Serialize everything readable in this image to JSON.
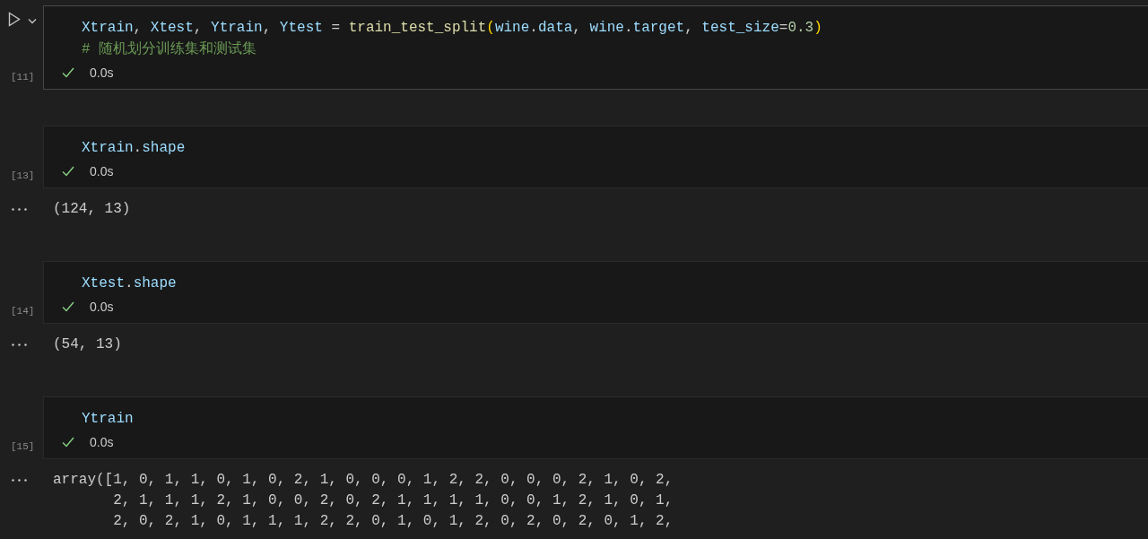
{
  "cells": [
    {
      "focused": true,
      "execution_count": "[11]",
      "succeeded": true,
      "duration": "0.0s",
      "code": [
        [
          {
            "t": "Xtrain",
            "kind": "var"
          },
          {
            "t": ", ",
            "kind": "plain"
          },
          {
            "t": "Xtest",
            "kind": "var"
          },
          {
            "t": ", ",
            "kind": "plain"
          },
          {
            "t": "Ytrain",
            "kind": "var"
          },
          {
            "t": ", ",
            "kind": "plain"
          },
          {
            "t": "Ytest",
            "kind": "var"
          },
          {
            "t": " = ",
            "kind": "plain"
          },
          {
            "t": "train_test_split",
            "kind": "func"
          },
          {
            "t": "(",
            "kind": "bracket"
          },
          {
            "t": "wine",
            "kind": "var"
          },
          {
            "t": ".",
            "kind": "plain"
          },
          {
            "t": "data",
            "kind": "var"
          },
          {
            "t": ", ",
            "kind": "plain"
          },
          {
            "t": "wine",
            "kind": "var"
          },
          {
            "t": ".",
            "kind": "plain"
          },
          {
            "t": "target",
            "kind": "var"
          },
          {
            "t": ", ",
            "kind": "plain"
          },
          {
            "t": "test_size",
            "kind": "var"
          },
          {
            "t": "=",
            "kind": "plain"
          },
          {
            "t": "0.3",
            "kind": "number"
          },
          {
            "t": ")",
            "kind": "bracket"
          }
        ],
        [
          {
            "t": "# 随机划分训练集和测试集",
            "kind": "comment"
          }
        ]
      ]
    },
    {
      "focused": false,
      "execution_count": "[13]",
      "succeeded": true,
      "duration": "0.0s",
      "code": [
        [
          {
            "t": "Xtrain",
            "kind": "var"
          },
          {
            "t": ".",
            "kind": "plain"
          },
          {
            "t": "shape",
            "kind": "var"
          }
        ]
      ],
      "output": [
        "(124, 13)"
      ]
    },
    {
      "focused": false,
      "execution_count": "[14]",
      "succeeded": true,
      "duration": "0.0s",
      "code": [
        [
          {
            "t": "Xtest",
            "kind": "var"
          },
          {
            "t": ".",
            "kind": "plain"
          },
          {
            "t": "shape",
            "kind": "var"
          }
        ]
      ],
      "output": [
        "(54, 13)"
      ]
    },
    {
      "focused": false,
      "execution_count": "[15]",
      "succeeded": true,
      "duration": "0.0s",
      "code": [
        [
          {
            "t": "Ytrain",
            "kind": "var"
          }
        ]
      ],
      "output": [
        "array([1, 0, 1, 1, 0, 1, 0, 2, 1, 0, 0, 0, 1, 2, 2, 0, 0, 0, 2, 1, 0, 2,",
        "       2, 1, 1, 1, 2, 1, 0, 0, 2, 0, 2, 1, 1, 1, 1, 0, 0, 1, 2, 1, 0, 1,",
        "       2, 0, 2, 1, 0, 1, 1, 1, 2, 2, 0, 1, 0, 1, 2, 0, 2, 0, 2, 0, 1, 2,"
      ]
    }
  ]
}
